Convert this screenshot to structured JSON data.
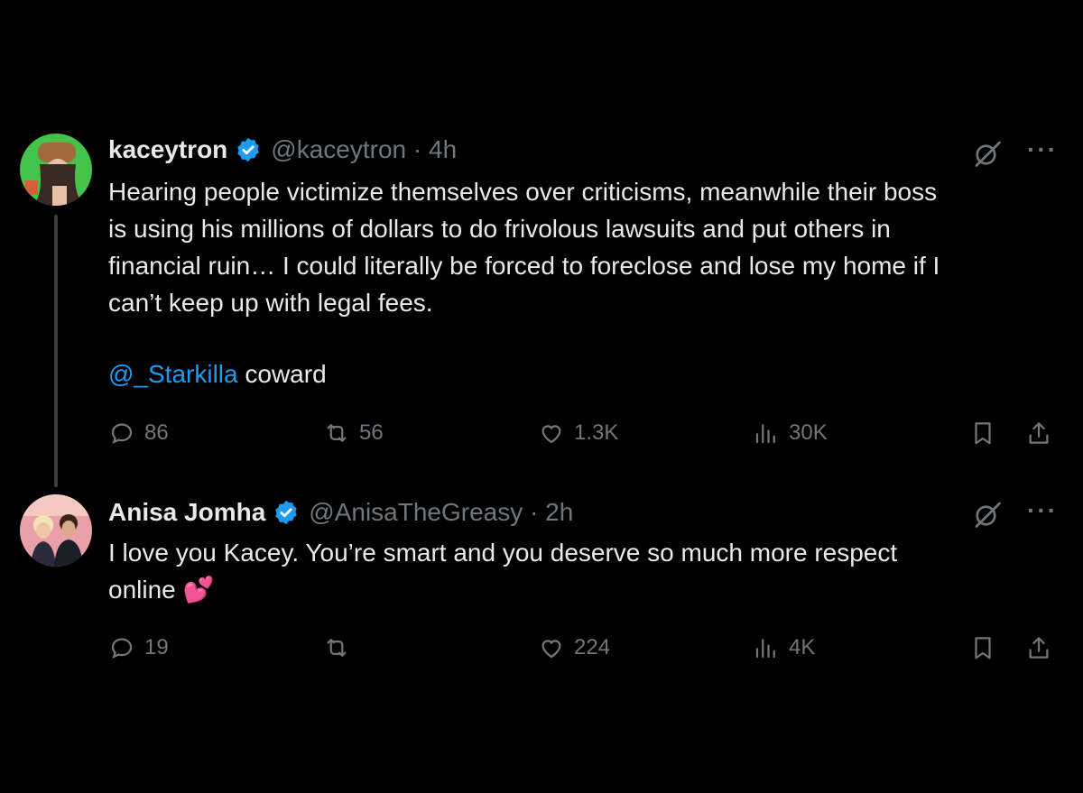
{
  "colors": {
    "background": "#000000",
    "text": "#e7e9ea",
    "muted": "#71767b",
    "link": "#1d9bf0",
    "verified": "#1d9bf0"
  },
  "tweets": [
    {
      "name": "kaceytron",
      "handle_time": "@kaceytron · 4h",
      "text": "Hearing people victimize themselves over criticisms, meanwhile their boss\nis using his millions of dollars to do frivolous lawsuits and put others in\nfinancial ruin… I could literally be forced to foreclose and lose my home if I\ncan’t keep up with legal fees.",
      "mention": "@_Starkilla",
      "mention_suffix": " coward",
      "replies": "86",
      "reposts": "56",
      "likes": "1.3K",
      "views": "30K",
      "icons": [
        "verified-badge-icon",
        "grok-icon",
        "more-icon",
        "reply-icon",
        "repost-icon",
        "like-icon",
        "views-icon",
        "bookmark-icon",
        "share-icon"
      ]
    },
    {
      "name": "Anisa Jomha",
      "handle_time": "@AnisaTheGreasy · 2h",
      "text": "I love you Kacey. You’re smart and you deserve so much more respect\nonline ",
      "emoji": "💕",
      "replies": "19",
      "reposts": "",
      "likes": "224",
      "views": "4K",
      "icons": [
        "verified-badge-icon",
        "grok-icon",
        "more-icon",
        "reply-icon",
        "repost-icon",
        "like-icon",
        "views-icon",
        "bookmark-icon",
        "share-icon"
      ]
    }
  ],
  "more_glyph": "···"
}
